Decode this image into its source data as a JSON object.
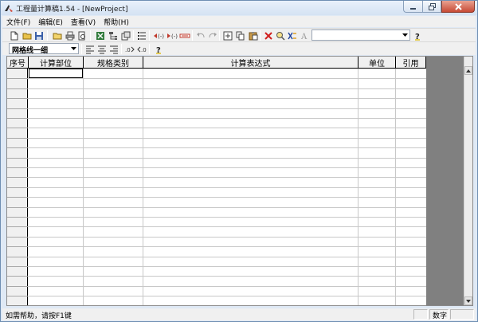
{
  "window": {
    "title": "工程量计算稿1.54 - [NewProject]"
  },
  "menu": {
    "items": [
      {
        "label": "文件(F)"
      },
      {
        "label": "编辑(E)"
      },
      {
        "label": "查看(V)"
      },
      {
        "label": "帮助(H)"
      }
    ]
  },
  "toolbar": {
    "grid_style": "网格线一细",
    "combo_value": ""
  },
  "table": {
    "columns": [
      "序号",
      "计算部位",
      "规格类别",
      "计算表达式",
      "单位",
      "引用"
    ],
    "row_count": 24
  },
  "status": {
    "help_text": "如需帮助，请按F1键",
    "panel_mode": "数字"
  },
  "colors": {
    "title_bg": "#dbe6f4",
    "chrome_bg": "#f0f0f0",
    "close_red": "#c74a35",
    "grid_empty": "#808080"
  },
  "icons": [
    "app-icon",
    "new-icon",
    "open-icon",
    "save-icon",
    "folder-icon",
    "print-icon",
    "preview-icon",
    "excel-icon",
    "tree-icon",
    "copy-format-icon",
    "list-icon",
    "indent-left-icon",
    "indent-right-icon",
    "link-icon",
    "undo-icon",
    "redo-icon",
    "insert-row-icon",
    "copy-icon",
    "paste-icon",
    "delete-icon",
    "find-icon",
    "calc-icon",
    "font-icon",
    "help-icon"
  ]
}
